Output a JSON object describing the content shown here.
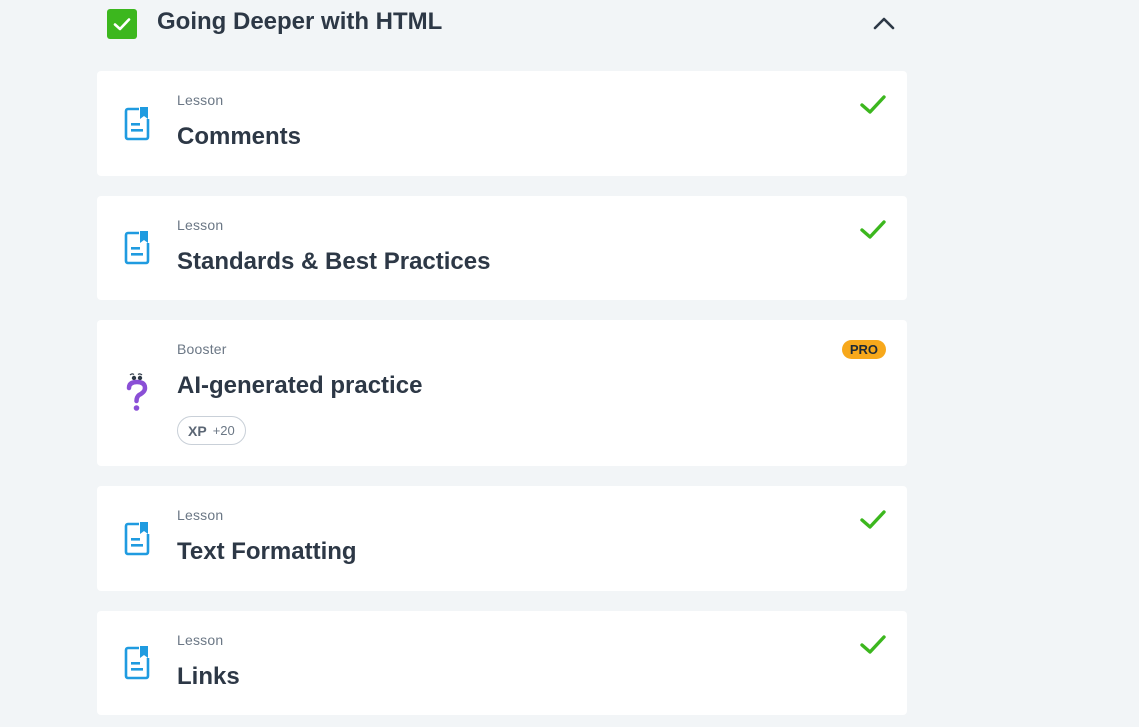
{
  "section": {
    "title": "Going Deeper with HTML",
    "completed": true,
    "expanded": true
  },
  "items": [
    {
      "type": "Lesson",
      "title": "Comments",
      "icon": "lesson-document-icon",
      "completed": true
    },
    {
      "type": "Lesson",
      "title": "Standards & Best Practices",
      "icon": "lesson-document-icon",
      "completed": true
    },
    {
      "type": "Booster",
      "title": "AI-generated practice",
      "icon": "question-mark-icon",
      "badge": "PRO",
      "xp_label": "XP",
      "xp_value": "+20"
    },
    {
      "type": "Lesson",
      "title": "Text Formatting",
      "icon": "lesson-document-icon",
      "completed": true
    },
    {
      "type": "Lesson",
      "title": "Links",
      "icon": "lesson-document-icon",
      "completed": true
    }
  ],
  "colors": {
    "background": "#f2f5f7",
    "card": "#ffffff",
    "success_green": "#3cb71e",
    "lesson_icon_blue": "#1f9be0",
    "booster_purple": "#8a4fd6",
    "pro_badge": "#f7a81b",
    "text_dark": "#2d3846",
    "text_muted": "#6b7785"
  }
}
